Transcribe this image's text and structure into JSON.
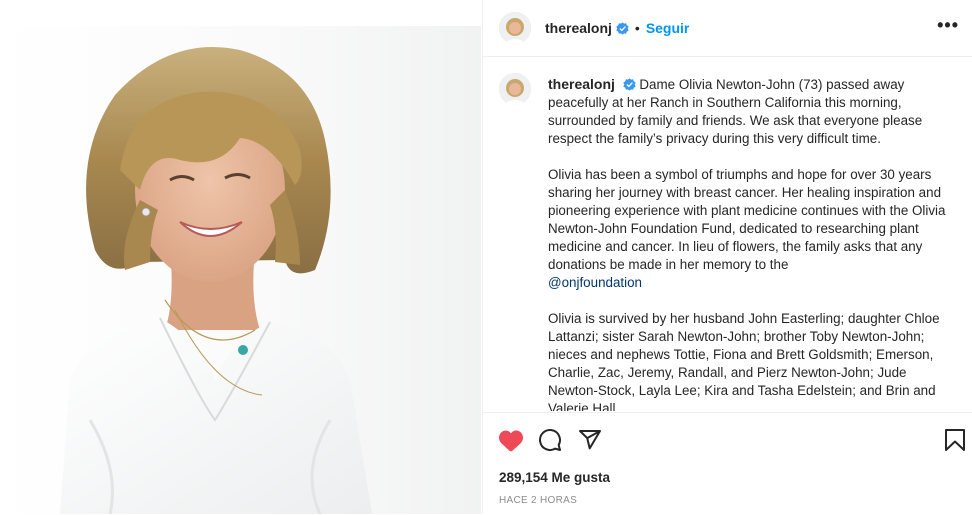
{
  "post": {
    "username": "therealonj",
    "follow_label": "Seguir",
    "separator": "•",
    "more_label": "•••"
  },
  "caption": {
    "username": "therealonj",
    "paragraph1": "Dame Olivia Newton-John (73) passed away peacefully at her Ranch in Southern California this morning, surrounded by family and friends. We ask that everyone please respect the family’s privacy during this very difficult time.",
    "paragraph2": "Olivia has been a symbol of triumphs and hope for over 30 years sharing her journey with breast cancer. Her healing inspiration and pioneering experience with plant medicine continues with the Olivia Newton-John Foundation Fund, dedicated to researching plant medicine and cancer. In lieu of flowers, the family asks that any donations be made in her memory to the",
    "mention": "@onjfoundation",
    "paragraph3": "Olivia is survived by her husband John Easterling; daughter Chloe Lattanzi; sister Sarah Newton-John; brother Toby Newton-John; nieces and nephews Tottie, Fiona and Brett Goldsmith; Emerson, Charlie, Zac, Jeremy, Randall, and Pierz Newton-John; Jude Newton-Stock, Layla Lee; Kira and Tasha Edelstein; and Brin and Valerie Hall."
  },
  "footer": {
    "likes": "289,154 Me gusta",
    "time_ago": "HACE 2 HORAS"
  },
  "colors": {
    "accent": "#0095f6",
    "like_red": "#ed4956",
    "verified_blue": "#3897f0",
    "mention": "#00376b"
  }
}
